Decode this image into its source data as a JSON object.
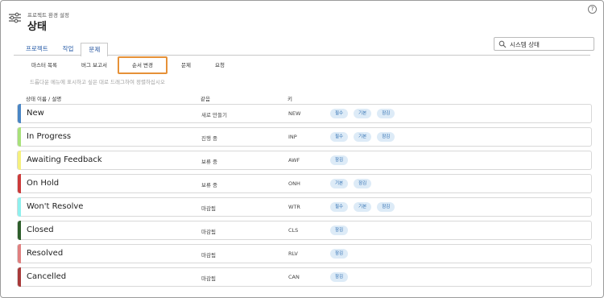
{
  "header": {
    "breadcrumb": "프로젝트 환경 설정",
    "title": "상태",
    "help_label": "?"
  },
  "tabs": [
    {
      "label": "프로젝트",
      "active": false
    },
    {
      "label": "작업",
      "active": false
    },
    {
      "label": "문제",
      "active": true
    }
  ],
  "search": {
    "value": "시스템 상태"
  },
  "subtabs": [
    {
      "label": "마스터 목록",
      "selected": false
    },
    {
      "label": "버그 보고서",
      "selected": false
    },
    {
      "label": "순서 변경",
      "selected": true
    },
    {
      "label": "문제",
      "selected": false
    },
    {
      "label": "요청",
      "selected": false
    }
  ],
  "hint": "드롭다운 메뉴에 표시하고 싶은 대로 드래그하여 정렬하십시오",
  "columns": {
    "name": "상태 이름 / 설명",
    "equals": "같음",
    "key": "키"
  },
  "colors": {
    "accent": "#e69138",
    "badge_bg": "#ddebf7",
    "badge_text": "#2a6bb0"
  },
  "rows": [
    {
      "name": "New",
      "equals": "새로 만들기",
      "key": "NEW",
      "color": "#4a86c5",
      "badges": [
        "필수",
        "기본",
        "잠김"
      ]
    },
    {
      "name": "In Progress",
      "equals": "진행 중",
      "key": "INP",
      "color": "#a8e17a",
      "badges": [
        "필수",
        "기본",
        "잠김"
      ]
    },
    {
      "name": "Awaiting Feedback",
      "equals": "보류 중",
      "key": "AWF",
      "color": "#f5f07d",
      "badges": [
        "잠김"
      ]
    },
    {
      "name": "On Hold",
      "equals": "보류 중",
      "key": "ONH",
      "color": "#cc3b3b",
      "badges": [
        "기본",
        "잠김"
      ]
    },
    {
      "name": "Won't Resolve",
      "equals": "마감됨",
      "key": "WTR",
      "color": "#8ef0ee",
      "badges": [
        "필수",
        "기본",
        "잠김"
      ]
    },
    {
      "name": "Closed",
      "equals": "마감됨",
      "key": "CLS",
      "color": "#2e5e2b",
      "badges": [
        "잠김"
      ]
    },
    {
      "name": "Resolved",
      "equals": "마감됨",
      "key": "RLV",
      "color": "#e08080",
      "badges": [
        "잠김"
      ]
    },
    {
      "name": "Cancelled",
      "equals": "마감됨",
      "key": "CAN",
      "color": "#a83a3a",
      "badges": [
        "잠김"
      ]
    }
  ]
}
